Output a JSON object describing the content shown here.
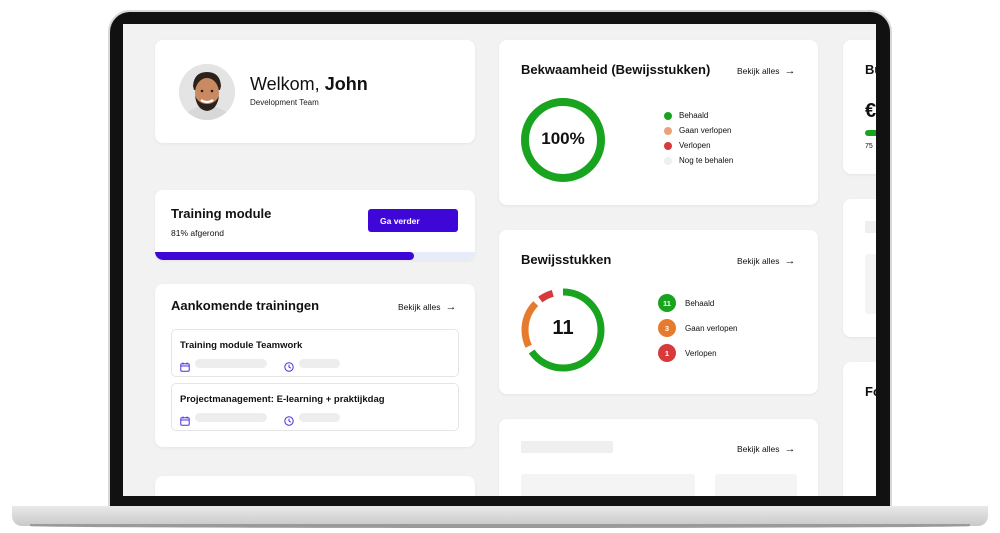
{
  "welcome": {
    "greeting": "Welkom,",
    "name": "John",
    "team": "Development Team"
  },
  "training_module": {
    "title": "Training module",
    "progress_text": "81% afgerond",
    "progress_value": 0.81,
    "button_label": "Ga verder"
  },
  "upcoming": {
    "title": "Aankomende trainingen",
    "link": "Bekijk alles",
    "items": [
      {
        "title": "Training module Teamwork",
        "calendar_icon": "calendar-icon",
        "clock_icon": "clock-icon"
      },
      {
        "title": "Projectmanagement: E-learning + praktijkdag",
        "calendar_icon": "calendar-icon",
        "clock_icon": "clock-icon"
      }
    ]
  },
  "competence": {
    "title": "Bekwaamheid (Bewijsstukken)",
    "link": "Bekijk alles",
    "ring_label": "100%",
    "ring_fraction": 1.0,
    "legend": [
      {
        "label": "Behaald",
        "color": "#19a41f"
      },
      {
        "label": "Gaan verlopen",
        "color": "#e9a27a"
      },
      {
        "label": "Verlopen",
        "color": "#d63a3a"
      },
      {
        "label": "Nog te behalen",
        "color": "#efefef"
      }
    ]
  },
  "evidence": {
    "title": "Bewijsstukken",
    "link": "Bekijk alles",
    "ring_label": "11",
    "legend": [
      {
        "count": "11",
        "label": "Behaald",
        "color": "#19a41f"
      },
      {
        "count": "3",
        "label": "Gaan verlopen",
        "color": "#e67b2e"
      },
      {
        "count": "1",
        "label": "Verlopen",
        "color": "#d63a3a"
      }
    ]
  },
  "bottom_card": {
    "link": "Bekijk alles"
  },
  "right_column": {
    "top_text": "Bu",
    "euro_symbol": "€",
    "small_text": "75",
    "third_text": "Fo"
  },
  "colors": {
    "accent": "#3f06d8",
    "green": "#19a41f",
    "orange": "#e67b2e",
    "red": "#d63a3a"
  }
}
